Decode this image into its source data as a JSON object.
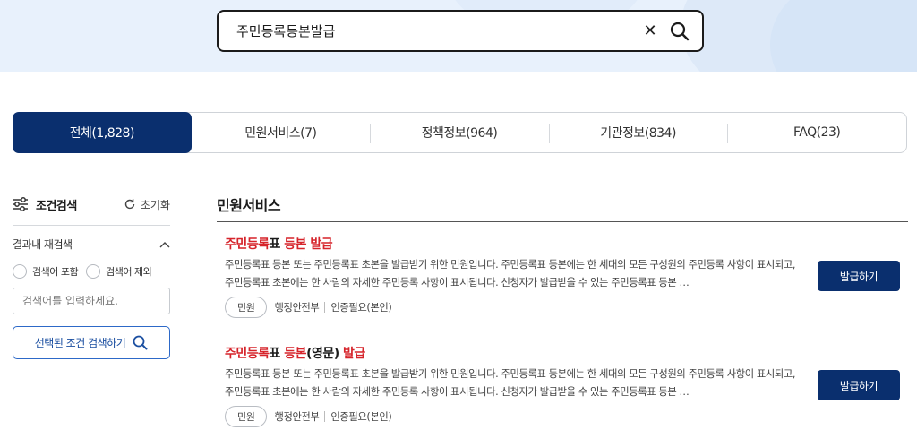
{
  "search": {
    "query": "주민등록등본발급",
    "clear_icon": "close-icon",
    "search_icon": "search-icon"
  },
  "tabs": [
    {
      "label": "전체(1,828)",
      "active": true
    },
    {
      "label": "민원서비스(7)",
      "active": false
    },
    {
      "label": "정책정보(964)",
      "active": false
    },
    {
      "label": "기관정보(834)",
      "active": false
    },
    {
      "label": "FAQ(23)",
      "active": false
    }
  ],
  "sidebar": {
    "title": "조건검색",
    "title_icon": "sliders-icon",
    "reset_label": "초기화",
    "reset_icon": "refresh-icon",
    "within_label": "결과내 재검색",
    "within_icon": "chevron-up-icon",
    "radio_include": "검색어 포함",
    "radio_exclude": "검색어 제외",
    "input_placeholder": "검색어를 입력하세요.",
    "search_button": "선택된 조건 검색하기"
  },
  "main": {
    "section_title": "민원서비스",
    "results": [
      {
        "title_parts": [
          {
            "text": "주민등록",
            "hl": true
          },
          {
            "text": "표 ",
            "hl": false
          },
          {
            "text": "등본 발급",
            "hl": true
          }
        ],
        "description": "주민등록표 등본 또는 주민등록표 초본을 발급받기 위한 민원입니다. 주민등록표 등본에는 한 세대의 모든 구성원의 주민등록 사항이 표시되고, 주민등록표 초본에는 한 사람의 자세한 주민등록 사항이 표시됩니다. 신청자가 발급받을 수 있는 주민등록표 등본 …",
        "badge": "민원",
        "agency": "행정안전부",
        "auth": "인증필요(본인)",
        "button": "발급하기"
      },
      {
        "title_parts": [
          {
            "text": "주민등록",
            "hl": true
          },
          {
            "text": "표 ",
            "hl": false
          },
          {
            "text": "등본",
            "hl": true
          },
          {
            "text": "(영문) ",
            "hl": false
          },
          {
            "text": "발급",
            "hl": true
          }
        ],
        "description": "주민등록표 등본 또는 주민등록표 초본을 발급받기 위한 민원입니다. 주민등록표 등본에는 한 세대의 모든 구성원의 주민등록 사항이 표시되고, 주민등록표 초본에는 한 사람의 자세한 주민등록 사항이 표시됩니다. 신청자가 발급받을 수 있는 주민등록표 등본 …",
        "badge": "민원",
        "agency": "행정안전부",
        "auth": "인증필요(본인)",
        "button": "발급하기"
      }
    ]
  },
  "colors": {
    "primary": "#0a2f6e",
    "highlight": "#d6242b",
    "banner": "#e8f1fc"
  }
}
